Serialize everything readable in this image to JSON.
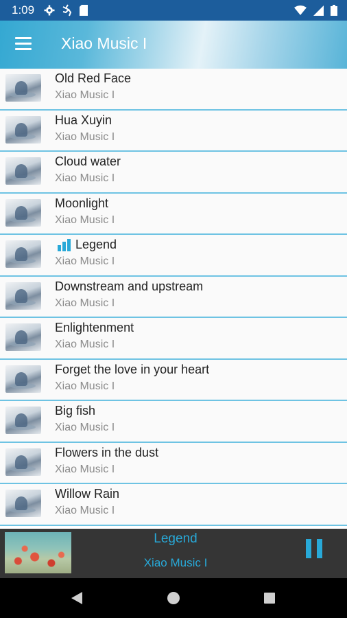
{
  "status_bar": {
    "time": "1:09",
    "left_icons": [
      "settings-icon",
      "running-app-icon",
      "sd-card-icon"
    ],
    "right_icons": [
      "wifi-icon",
      "signal-icon",
      "battery-icon"
    ]
  },
  "app_bar": {
    "title": "Xiao Music I",
    "menu_icon": "menu-icon"
  },
  "songs": [
    {
      "title": "Old Red Face",
      "artist": "Xiao Music I",
      "playing": false
    },
    {
      "title": "Hua Xuyin",
      "artist": "Xiao Music I",
      "playing": false
    },
    {
      "title": "Cloud water",
      "artist": "Xiao Music I",
      "playing": false
    },
    {
      "title": "Moonlight",
      "artist": "Xiao Music I",
      "playing": false
    },
    {
      "title": "Legend",
      "artist": "Xiao Music I",
      "playing": true
    },
    {
      "title": "Downstream and upstream",
      "artist": "Xiao Music I",
      "playing": false
    },
    {
      "title": "Enlightenment",
      "artist": "Xiao Music I",
      "playing": false
    },
    {
      "title": "Forget the love in your heart",
      "artist": "Xiao Music I",
      "playing": false
    },
    {
      "title": "Big fish",
      "artist": "Xiao Music I",
      "playing": false
    },
    {
      "title": "Flowers in the dust",
      "artist": "Xiao Music I",
      "playing": false
    },
    {
      "title": "Willow Rain",
      "artist": "Xiao Music I",
      "playing": false
    }
  ],
  "now_playing": {
    "title": "Legend",
    "artist": "Xiao Music I",
    "state_icon": "pause-icon"
  },
  "colors": {
    "accent": "#28a9d8",
    "status_bar": "#1c5d9c",
    "player_bg": "#353535",
    "divider": "#6ec3e3"
  },
  "nav_bar": {
    "icons": [
      "back-icon",
      "home-icon",
      "recents-icon"
    ]
  }
}
